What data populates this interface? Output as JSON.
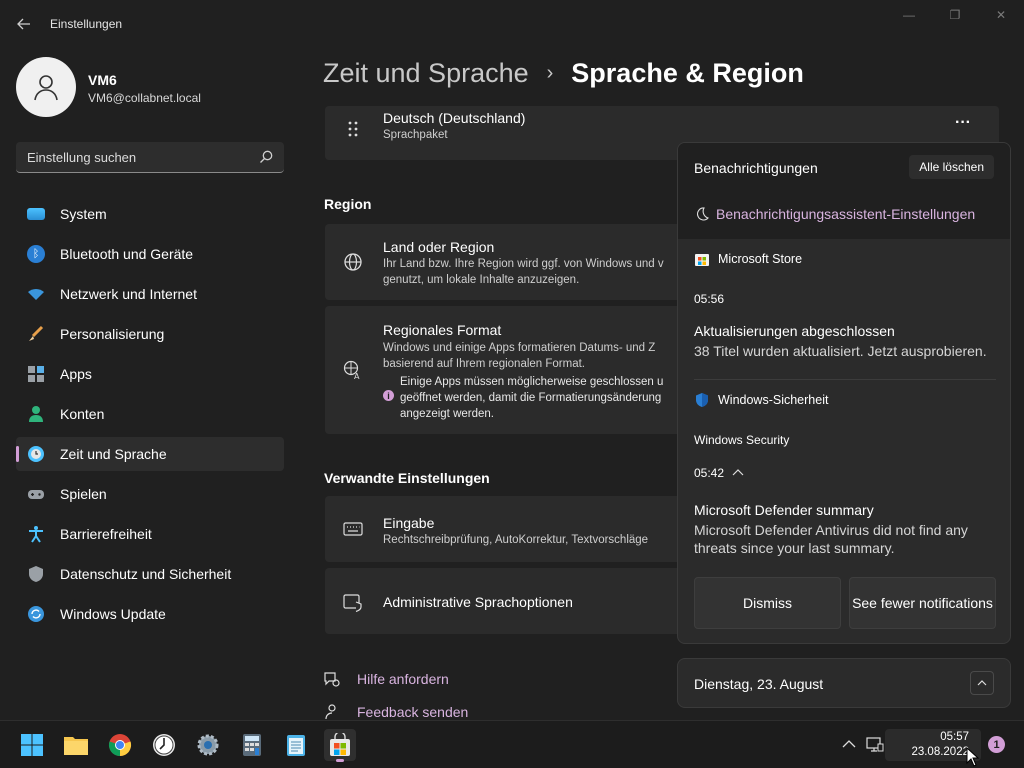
{
  "window": {
    "title": "Einstellungen",
    "back_icon": "back-arrow-icon",
    "minimize": "—",
    "restore": "❐",
    "close": "✕"
  },
  "user": {
    "name": "VM6",
    "email": "VM6@collabnet.local"
  },
  "search": {
    "placeholder": "Einstellung suchen"
  },
  "sidebar": {
    "items": [
      {
        "label": "System",
        "icon": "monitor-icon",
        "color": "#4cc2ff"
      },
      {
        "label": "Bluetooth und Geräte",
        "icon": "bluetooth-icon",
        "color": "#3a96dd"
      },
      {
        "label": "Netzwerk und Internet",
        "icon": "wifi-icon",
        "color": "#3a96dd"
      },
      {
        "label": "Personalisierung",
        "icon": "brush-icon",
        "color": "#e8a04a"
      },
      {
        "label": "Apps",
        "icon": "apps-icon",
        "color": "#9aa0a6"
      },
      {
        "label": "Konten",
        "icon": "person-icon",
        "color": "#2fb47c"
      },
      {
        "label": "Zeit und Sprache",
        "icon": "clock-globe-icon",
        "color": "#4cc2ff"
      },
      {
        "label": "Spielen",
        "icon": "gamepad-icon",
        "color": "#9aa0a6"
      },
      {
        "label": "Barrierefreiheit",
        "icon": "accessibility-icon",
        "color": "#4cc2ff"
      },
      {
        "label": "Datenschutz und Sicherheit",
        "icon": "shield-icon",
        "color": "#9aa0a6"
      },
      {
        "label": "Windows Update",
        "icon": "update-icon",
        "color": "#4cc2ff"
      }
    ],
    "active_index": 6
  },
  "main": {
    "breadcrumb_parent": "Zeit und Sprache",
    "breadcrumb_current": "Sprache & Region",
    "language_card": {
      "title": "Deutsch (Deutschland)",
      "subtitle": "Sprachpaket",
      "more": "···"
    },
    "region_heading": "Region",
    "country_card": {
      "title": "Land oder Region",
      "line1": "Ihr Land bzw. Ihre Region wird ggf. von Windows und v",
      "line2": "genutzt, um lokale Inhalte anzuzeigen."
    },
    "format_card": {
      "title": "Regionales Format",
      "line1": "Windows und einige Apps formatieren Datums- und Z",
      "line2": "basierend auf Ihrem regionalen Format.",
      "warn1": "Einige Apps müssen möglicherweise geschlossen u",
      "warn2": "geöffnet werden, damit die Formatierungsänderung",
      "warn3": "angezeigt werden."
    },
    "related_heading": "Verwandte Einstellungen",
    "input_card": {
      "title": "Eingabe",
      "subtitle": "Rechtschreibprüfung, AutoKorrektur, Textvorschläge"
    },
    "admin_card": {
      "title": "Administrative Sprachoptionen"
    },
    "help_link": "Hilfe anfordern",
    "feedback_link": "Feedback senden"
  },
  "notifications": {
    "title": "Benachrichtigungen",
    "clear_all": "Alle löschen",
    "assist_link": "Benachrichtigungsassistent-Einstellungen",
    "store": {
      "source": "Microsoft Store",
      "time": "05:56",
      "headline": "Aktualisierungen abgeschlossen",
      "body": "38 Titel wurden aktualisiert. Jetzt ausprobieren."
    },
    "security": {
      "source": "Windows-Sicherheit",
      "app": "Windows Security",
      "time": "05:42",
      "headline": "Microsoft Defender summary",
      "body": "Microsoft Defender Antivirus did not find any threats since your last summary.",
      "dismiss": "Dismiss",
      "fewer": "See fewer notifications"
    }
  },
  "calendar": {
    "date": "Dienstag, 23. August"
  },
  "taskbar": {
    "time": "05:57",
    "date": "23.08.2022",
    "badge": "1"
  },
  "colors": {
    "accent": "#d29ed6",
    "link": "#d9b4e0",
    "background": "#202020",
    "card": "#2b2b2b"
  }
}
